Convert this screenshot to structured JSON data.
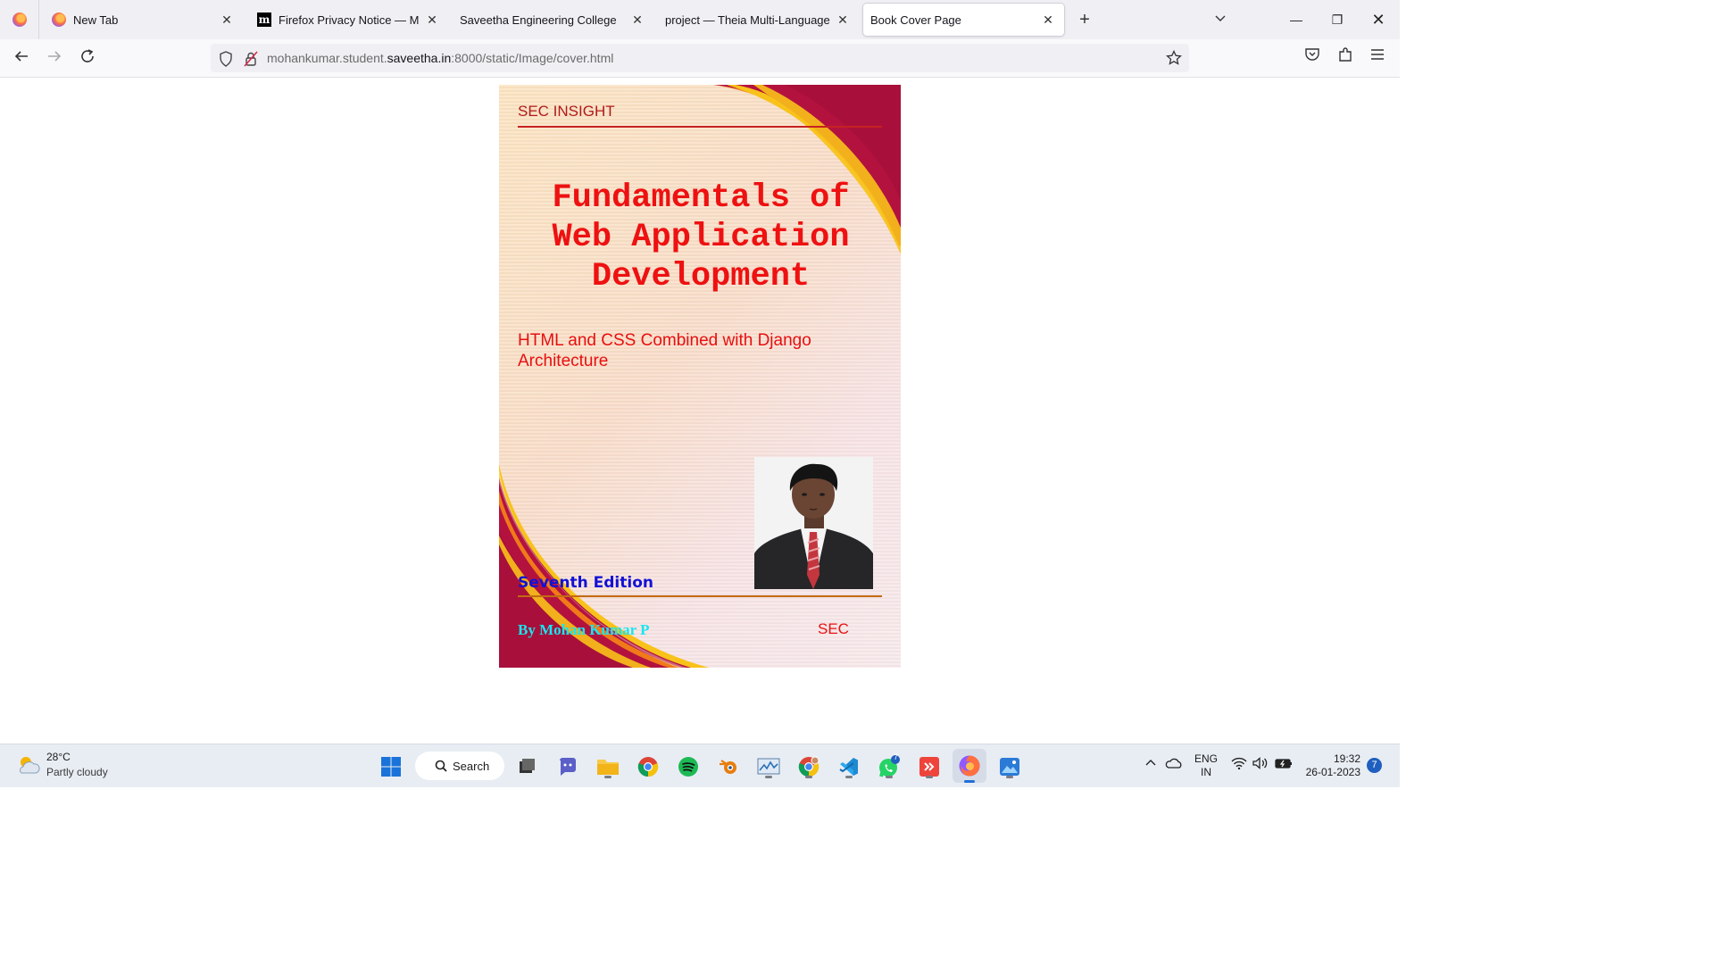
{
  "browser": {
    "tabs": [
      {
        "title": "New Tab",
        "favicon": "firefox-icon"
      },
      {
        "title": "Firefox Privacy Notice — Mozilla",
        "favicon": "mozilla-icon"
      },
      {
        "title": "Saveetha Engineering College",
        "favicon": ""
      },
      {
        "title": "project — Theia Multi-Language Ex",
        "favicon": ""
      },
      {
        "title": "Book Cover Page",
        "favicon": ""
      }
    ],
    "active_tab": 4,
    "url_prefix": "mohankumar.student.",
    "url_host": "saveetha.in",
    "url_suffix": ":8000/static/Image/cover.html"
  },
  "cover": {
    "brand": "SEC INSIGHT",
    "title_line1": "Fundamentals of",
    "title_line2": "Web Application",
    "title_line3": "Development",
    "subtitle": "HTML and CSS Combined with Django Architecture",
    "edition": "Seventh Edition",
    "author": "By Mohan Kumar P",
    "publisher": "SEC",
    "colors": {
      "title": "#ee1111",
      "edition": "#1212d6",
      "author": "#17e6f0",
      "swoosh_dark": "#b3123f",
      "swoosh_orange": "#f07a1a",
      "swoosh_yellow": "#f8c21a"
    }
  },
  "taskbar": {
    "weather_temp": "28°C",
    "weather_desc": "Partly cloudy",
    "search_label": "Search",
    "lang_line1": "ENG",
    "lang_line2": "IN",
    "time": "19:32",
    "date": "26-01-2023",
    "notification_count": "7",
    "whatsapp_badge": "7"
  }
}
